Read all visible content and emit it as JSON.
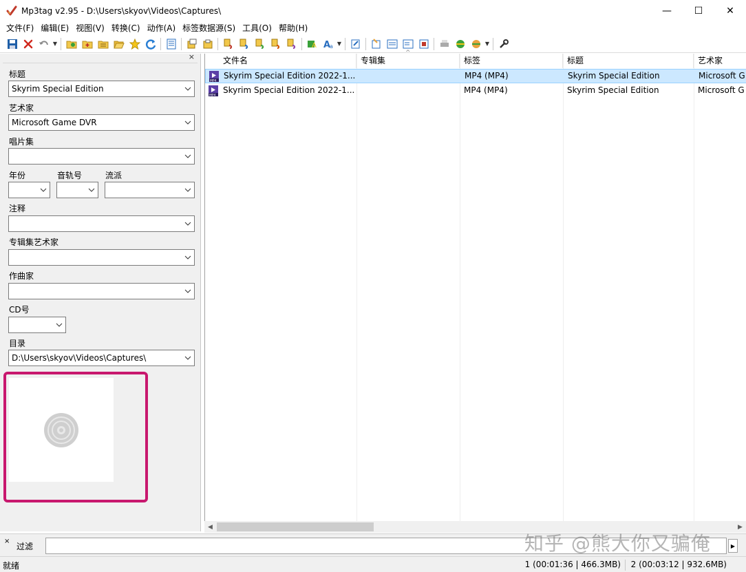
{
  "window": {
    "title": "Mp3tag v2.95  -  D:\\Users\\skyov\\Videos\\Captures\\",
    "minimize": "—",
    "maximize": "☐",
    "close": "✕"
  },
  "menu": {
    "items": [
      "文件(F)",
      "编辑(E)",
      "视图(V)",
      "转换(C)",
      "动作(A)",
      "标签数据源(S)",
      "工具(O)",
      "帮助(H)"
    ]
  },
  "tag_panel": {
    "close": "×",
    "title_label": "标题",
    "title_value": "Skyrim Special Edition",
    "artist_label": "艺术家",
    "artist_value": "Microsoft Game DVR",
    "album_label": "唱片集",
    "album_value": "",
    "year_label": "年份",
    "year_value": "",
    "track_label": "音轨号",
    "track_value": "",
    "genre_label": "流派",
    "genre_value": "",
    "comment_label": "注释",
    "comment_value": "",
    "album_artist_label": "专辑集艺术家",
    "album_artist_value": "",
    "composer_label": "作曲家",
    "composer_value": "",
    "cd_label": "CD号",
    "cd_value": "",
    "directory_label": "目录",
    "directory_value": "D:\\Users\\skyov\\Videos\\Captures\\"
  },
  "file_list": {
    "columns": [
      "文件名",
      "专辑集",
      "标签",
      "标题",
      "艺术家"
    ],
    "rows": [
      {
        "filename": "Skyrim Special Edition 2022-1...",
        "album": "",
        "tag": "MP4 (MP4)",
        "title": "Skyrim Special Edition",
        "artist": "Microsoft G",
        "selected": true
      },
      {
        "filename": "Skyrim Special Edition 2022-1...",
        "album": "",
        "tag": "MP4 (MP4)",
        "title": "Skyrim Special Edition",
        "artist": "Microsoft G",
        "selected": false
      }
    ]
  },
  "filter": {
    "close": "×",
    "label": "过滤",
    "value": ""
  },
  "status": {
    "text": "就绪",
    "selected": "1 (00:01:36 | 466.3MB)",
    "total": "2 (00:03:12 | 932.6MB)"
  },
  "watermark": "知乎 @熊大你又骗俺",
  "colors": {
    "selection": "#cce8ff",
    "highlight_frame": "#c8186e"
  }
}
